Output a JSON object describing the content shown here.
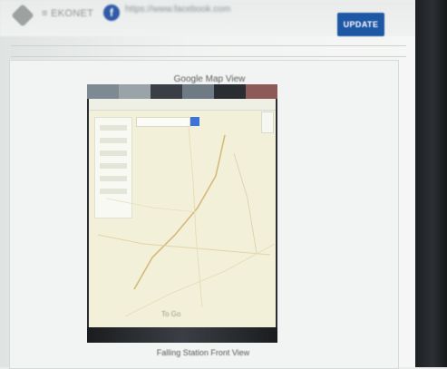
{
  "header": {
    "brand_name": "≡ EKONET",
    "social_text": "https://www.facebook.com",
    "update_button_label": "UPDATE"
  },
  "main": {
    "map_view_title": "Google Map View",
    "lower_view_title": "Falling Station Front View",
    "map_screenshot": {
      "label": "To Go"
    }
  },
  "colors": {
    "accent_button": "#1e57a4",
    "map_background": "#f2f0d8",
    "phone_frame": "#2a2d31"
  },
  "icons": [
    "brand-diamond-icon",
    "facebook-icon",
    "map-search-icon",
    "map-zoom-controls-icon"
  ]
}
